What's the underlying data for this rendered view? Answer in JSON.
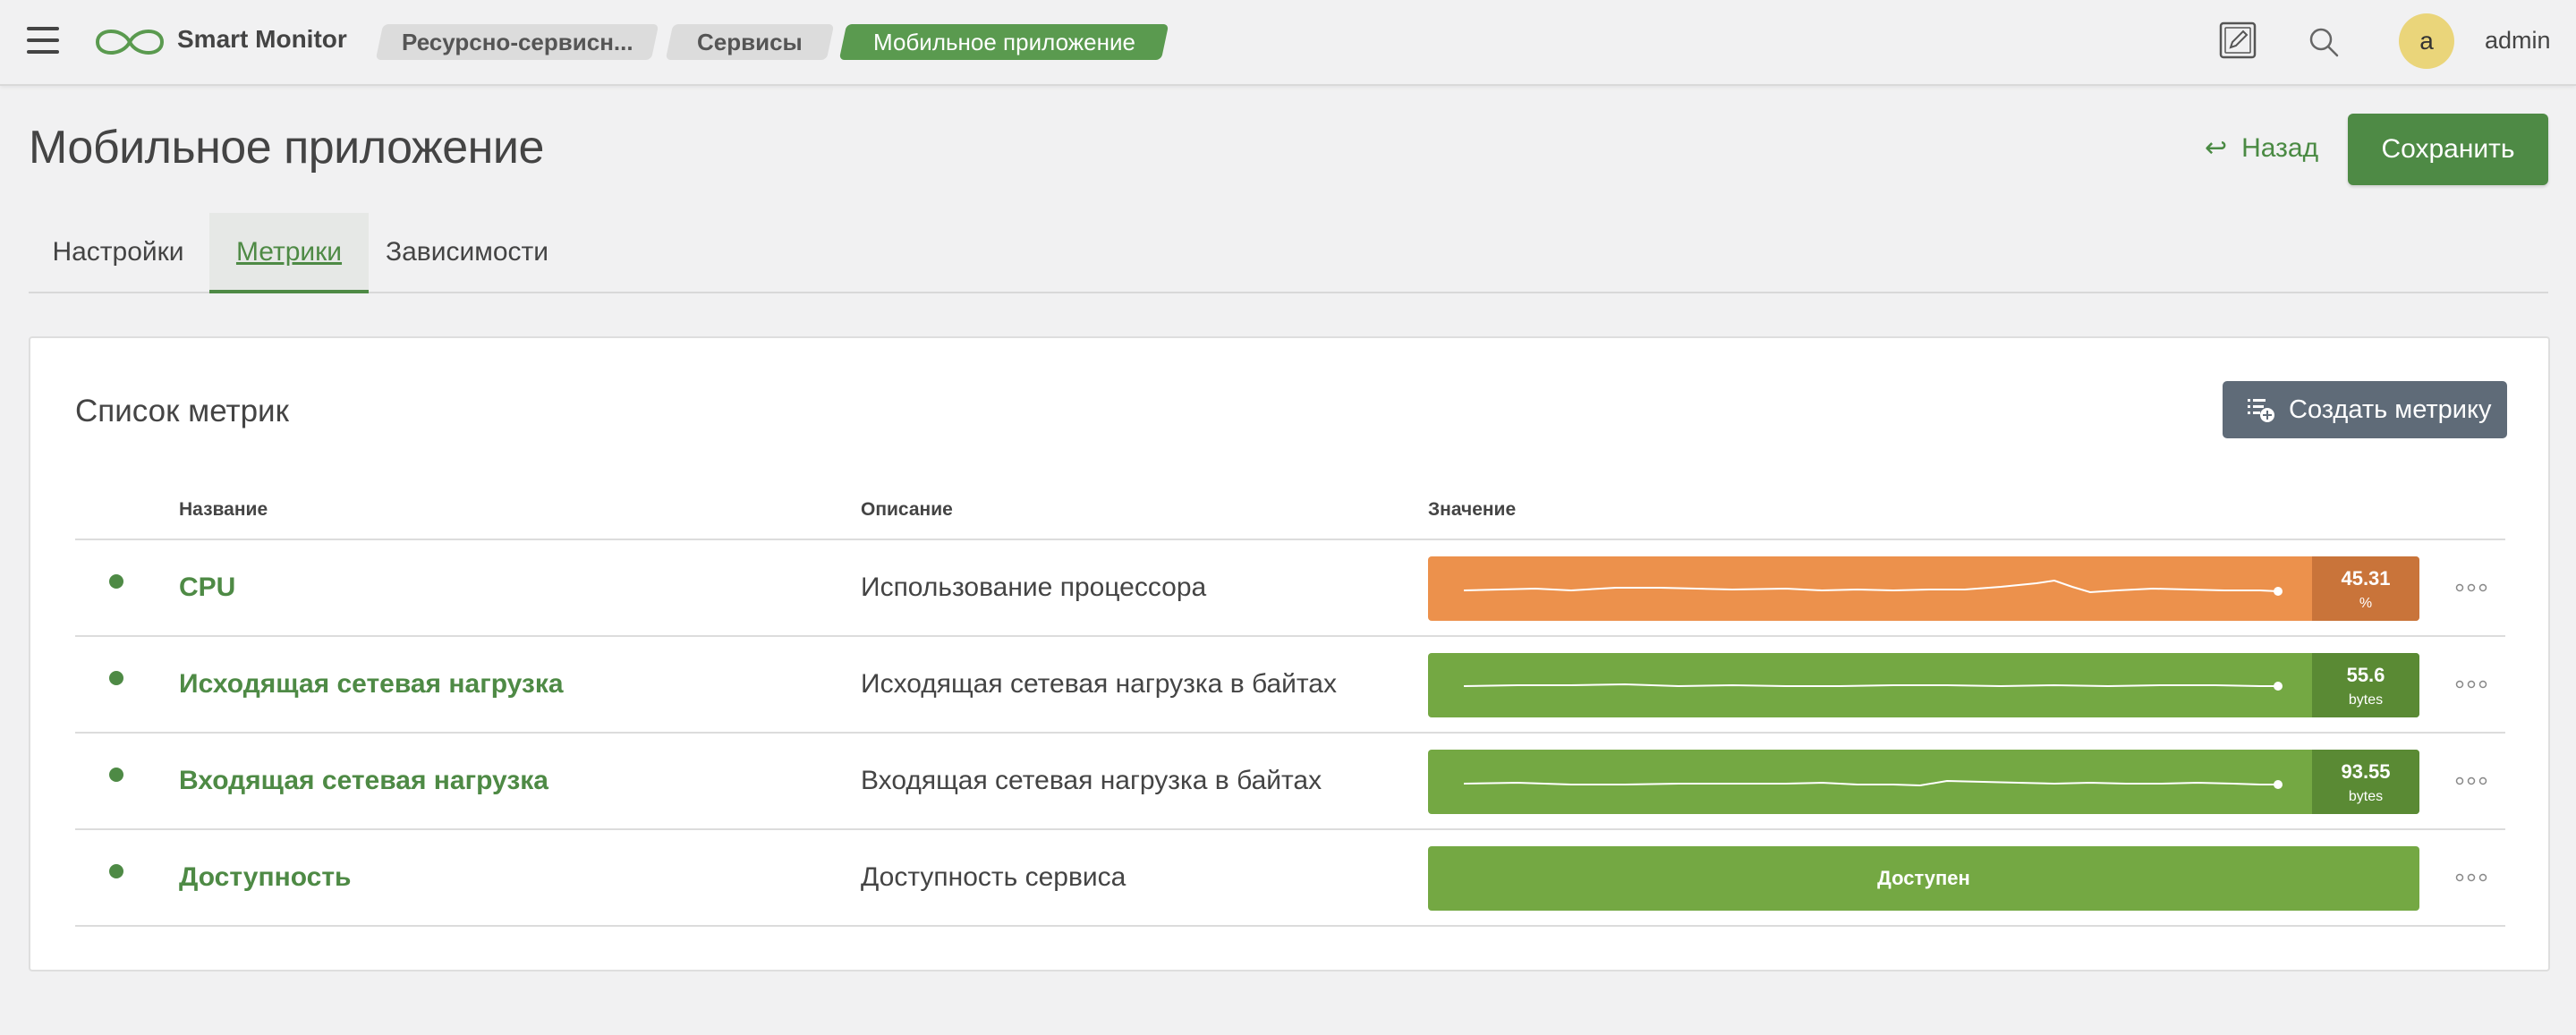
{
  "header": {
    "app_name": "Smart Monitor",
    "breadcrumbs": [
      "Ресурсно-сервисн...",
      "Сервисы",
      "Мобильное приложение"
    ],
    "user_initial": "a",
    "user_name": "admin"
  },
  "page": {
    "title": "Мобильное приложение",
    "back_label": "Назад",
    "save_label": "Сохранить"
  },
  "tabs": [
    {
      "label": "Настройки",
      "active": false
    },
    {
      "label": "Метрики",
      "active": true
    },
    {
      "label": "Зависимости",
      "active": false
    }
  ],
  "metrics_panel": {
    "title": "Список метрик",
    "create_label": "Создать метрику",
    "columns": [
      "Название",
      "Описание",
      "Значение"
    ],
    "rows": [
      {
        "name": "CPU",
        "description": "Использование процессора",
        "value": "45.31",
        "unit": "%",
        "status_color": "orange"
      },
      {
        "name": "Исходящая сетевая нагрузка",
        "description": "Исходящая сетевая нагрузка в байтах",
        "value": "55.6",
        "unit": "bytes",
        "status_color": "green"
      },
      {
        "name": "Входящая сетевая нагрузка",
        "description": "Входящая сетевая нагрузка в байтах",
        "value": "93.55",
        "unit": "bytes",
        "status_color": "green"
      },
      {
        "name": "Доступность",
        "description": "Доступность сервиса",
        "value": "Доступен",
        "unit": "",
        "status_color": "green"
      }
    ]
  },
  "colors": {
    "brand_green": "#4e8a45",
    "warning_orange": "#ec914c",
    "ok_green": "#74a843"
  }
}
